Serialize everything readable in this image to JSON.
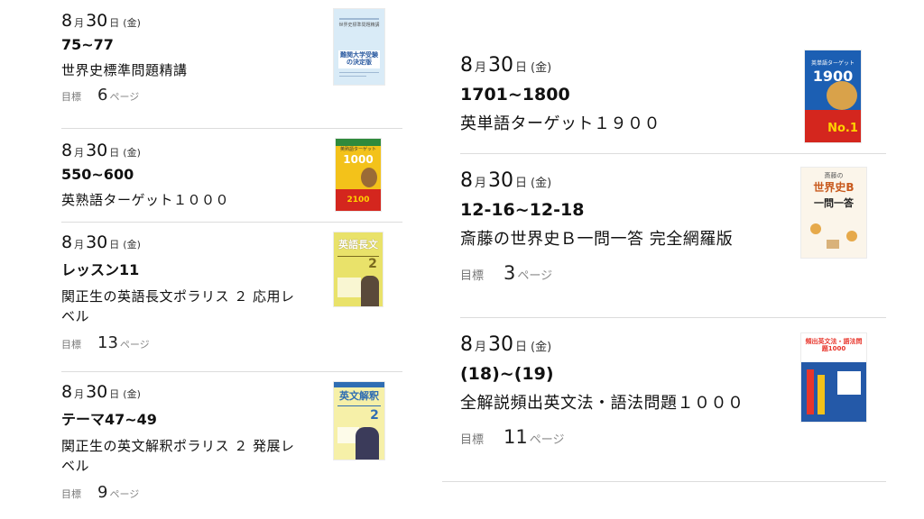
{
  "left_cards": [
    {
      "month": "8",
      "month_unit": "月",
      "day": "30",
      "day_unit": "日",
      "weekday": "(金)",
      "range": "75~77",
      "title": "世界史標準問題精講",
      "goal_label": "目標",
      "goal_value": "6",
      "goal_unit": "ページ",
      "cover": {
        "name": "world-history-standard-cover",
        "main": "難関大学受験の決定版",
        "top": "世界史標準問題精講",
        "color": "#d9ebf7",
        "accent": "#2a5aa0"
      }
    },
    {
      "month": "8",
      "month_unit": "月",
      "day": "30",
      "day_unit": "日",
      "weekday": "(金)",
      "range": "550~600",
      "title": "英熟語ターゲット１０００",
      "cover": {
        "name": "idiom-target-1000-cover",
        "main": "1000",
        "top": "英熟語ターゲット",
        "badge": "2100",
        "color": "#f3c21a",
        "accent": "#d4261e"
      }
    },
    {
      "month": "8",
      "month_unit": "月",
      "day": "30",
      "day_unit": "日",
      "weekday": "(金)",
      "range": "レッスン11",
      "title": "関正生の英語長文ポラリス ２ 応用レベル",
      "goal_label": "目標",
      "goal_value": "13",
      "goal_unit": "ページ",
      "cover": {
        "name": "polaris-reading-2-cover",
        "main": "英語長文",
        "number": "2",
        "color": "#e9e26a",
        "accent": "#7a6a1e"
      }
    },
    {
      "month": "8",
      "month_unit": "月",
      "day": "30",
      "day_unit": "日",
      "weekday": "(金)",
      "range": "テーマ47~49",
      "title": "関正生の英文解釈ポラリス ２ 発展レベル",
      "goal_label": "目標",
      "goal_value": "9",
      "goal_unit": "ページ",
      "cover": {
        "name": "polaris-interpretation-2-cover",
        "main": "英文解釈",
        "number": "2",
        "color": "#f6f0a8",
        "accent": "#2f6db3"
      }
    }
  ],
  "right_cards": [
    {
      "month": "8",
      "month_unit": "月",
      "day": "30",
      "day_unit": "日",
      "weekday": "(金)",
      "range": "1701~1800",
      "title": "英単語ターゲット１９００",
      "cover": {
        "name": "vocab-target-1900-cover",
        "main": "1900",
        "top": "英単語ターゲット",
        "badge": "No.1",
        "color": "#1c5fb3",
        "accent": "#d4261e"
      }
    },
    {
      "month": "8",
      "month_unit": "月",
      "day": "30",
      "day_unit": "日",
      "weekday": "(金)",
      "range": "12-16~12-18",
      "title": "斎藤の世界史Ｂ一問一答 完全網羅版",
      "goal_label": "目標",
      "goal_value": "3",
      "goal_unit": "ページ",
      "cover": {
        "name": "saito-world-history-cover",
        "main": "世界史B",
        "top": "斎藤の",
        "sub": "一問一答",
        "color": "#fbf5ea",
        "accent": "#c85a1e"
      }
    },
    {
      "month": "8",
      "month_unit": "月",
      "day": "30",
      "day_unit": "日",
      "weekday": "(金)",
      "range": "(18)~(19)",
      "title": "全解説頻出英文法・語法問題１０００",
      "goal_label": "目標",
      "goal_value": "11",
      "goal_unit": "ページ",
      "cover": {
        "name": "grammar-1000-cover",
        "main": "頻出英文法・語法問題1000",
        "color": "#2459a8",
        "accent": "#e8352b"
      }
    }
  ]
}
